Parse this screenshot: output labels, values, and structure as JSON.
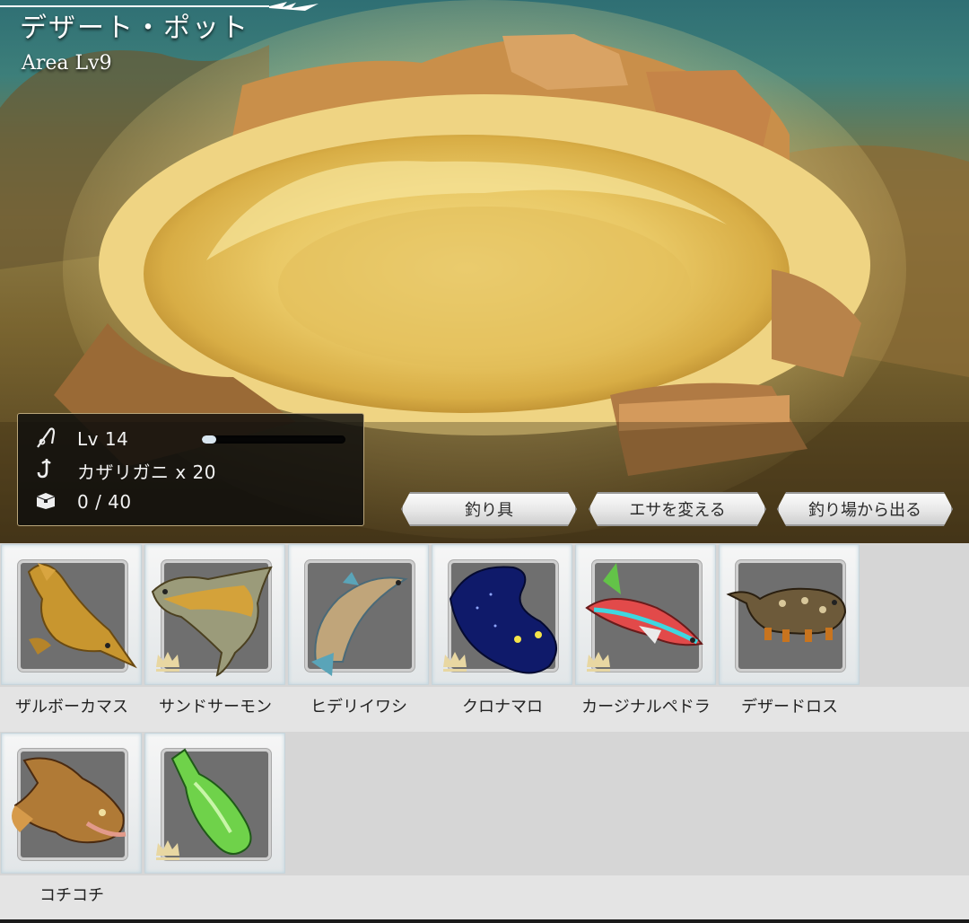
{
  "area": {
    "name": "デザート・ポット",
    "level": "Area Lv9"
  },
  "status": {
    "level_label": "Lv 14",
    "level_progress": 0.1,
    "bait_label": "カザリガニ x 20",
    "capacity_label": "0 / 40",
    "icons": [
      "fishing-rod-icon",
      "hook-icon",
      "treasure-chest-icon"
    ]
  },
  "actions": {
    "tackle": "釣り具",
    "change_bait": "エサを変える",
    "leave": "釣り場から出る"
  },
  "catches": [
    {
      "name": "ザルボーカマス",
      "crown": false,
      "icon": "golden-pike-fish"
    },
    {
      "name": "サンドサーモン",
      "crown": true,
      "icon": "sand-salmon-fish"
    },
    {
      "name": "ヒデリイワシ",
      "crown": false,
      "icon": "sardine-fish"
    },
    {
      "name": "クロナマロ",
      "crown": true,
      "icon": "dark-blue-blob-fish"
    },
    {
      "name": "カージナルペドラ",
      "crown": true,
      "icon": "neon-tetra-fish"
    },
    {
      "name": "デザードロス",
      "crown": false,
      "icon": "spotted-lizard-creature"
    },
    {
      "name": "コチコチ",
      "crown": false,
      "icon": "flathead-fish"
    },
    {
      "name": "",
      "crown": true,
      "icon": "green-bottle"
    }
  ],
  "colors": {
    "panel_border": "#b9a57a",
    "list_bg": "#d6d6d6",
    "crown": "#e8d7a2"
  }
}
